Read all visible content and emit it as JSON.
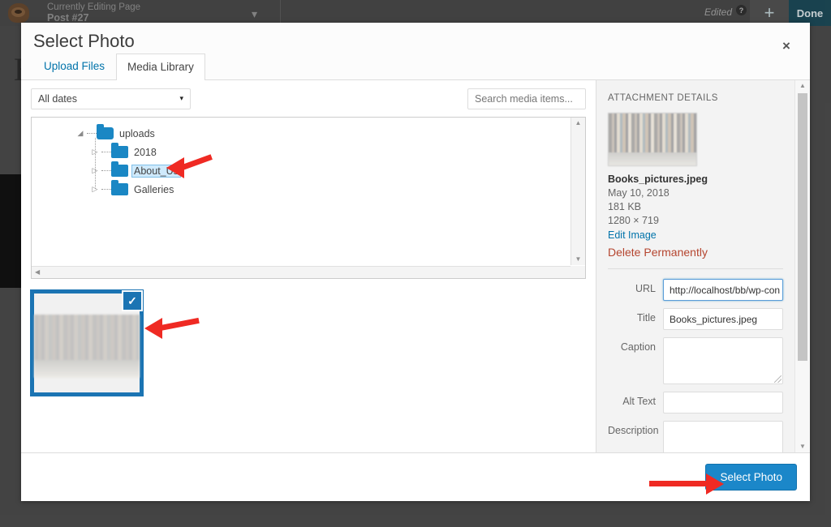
{
  "background": {
    "editing_label": "Currently Editing Page",
    "editing_target": "Post #27",
    "chevron_icon": "chevron-down",
    "edited_label": "Edited",
    "help_icon": "?",
    "add_icon": "+",
    "done_label": "Done",
    "page_letter": "B"
  },
  "modal": {
    "title": "Select Photo",
    "close_icon": "×",
    "tabs": [
      {
        "label": "Upload Files",
        "active": false
      },
      {
        "label": "Media Library",
        "active": true
      }
    ]
  },
  "toolbar": {
    "date_filter_value": "All dates",
    "date_filter_caret": "▾",
    "search_placeholder": "Search media items..."
  },
  "tree": {
    "root": {
      "label": "uploads",
      "expander": "◢"
    },
    "children": [
      {
        "label": "2018",
        "expander": "▷",
        "selected": false
      },
      {
        "label": "About_Us",
        "expander": "▷",
        "selected": true
      },
      {
        "label": "Galleries",
        "expander": "▷",
        "selected": false
      }
    ],
    "scroll_up_icon": "▲",
    "scroll_down_icon": "▼",
    "scroll_left_icon": "◀"
  },
  "grid": {
    "selected_check_icon": "✓"
  },
  "details": {
    "heading": "ATTACHMENT DETAILS",
    "filename": "Books_pictures.jpeg",
    "date": "May 10, 2018",
    "filesize": "181 KB",
    "dimensions": "1280 × 719",
    "edit_image_label": "Edit Image",
    "delete_label": "Delete Permanently",
    "fields": [
      {
        "label": "URL",
        "value": "http://localhost/bb/wp-con",
        "type": "input",
        "focused": true
      },
      {
        "label": "Title",
        "value": "Books_pictures.jpeg",
        "type": "input",
        "focused": false
      },
      {
        "label": "Caption",
        "value": "",
        "type": "textarea",
        "focused": false
      },
      {
        "label": "Alt Text",
        "value": "",
        "type": "input",
        "focused": false
      },
      {
        "label": "Description",
        "value": "",
        "type": "textarea",
        "focused": false
      }
    ]
  },
  "footer": {
    "select_photo_label": "Select Photo"
  },
  "colors": {
    "accent_blue": "#1b87c9",
    "link_blue": "#0073aa",
    "folder_blue": "#1a87c4",
    "delete_red": "#b5452f",
    "arrow_red": "#ef2a23"
  }
}
